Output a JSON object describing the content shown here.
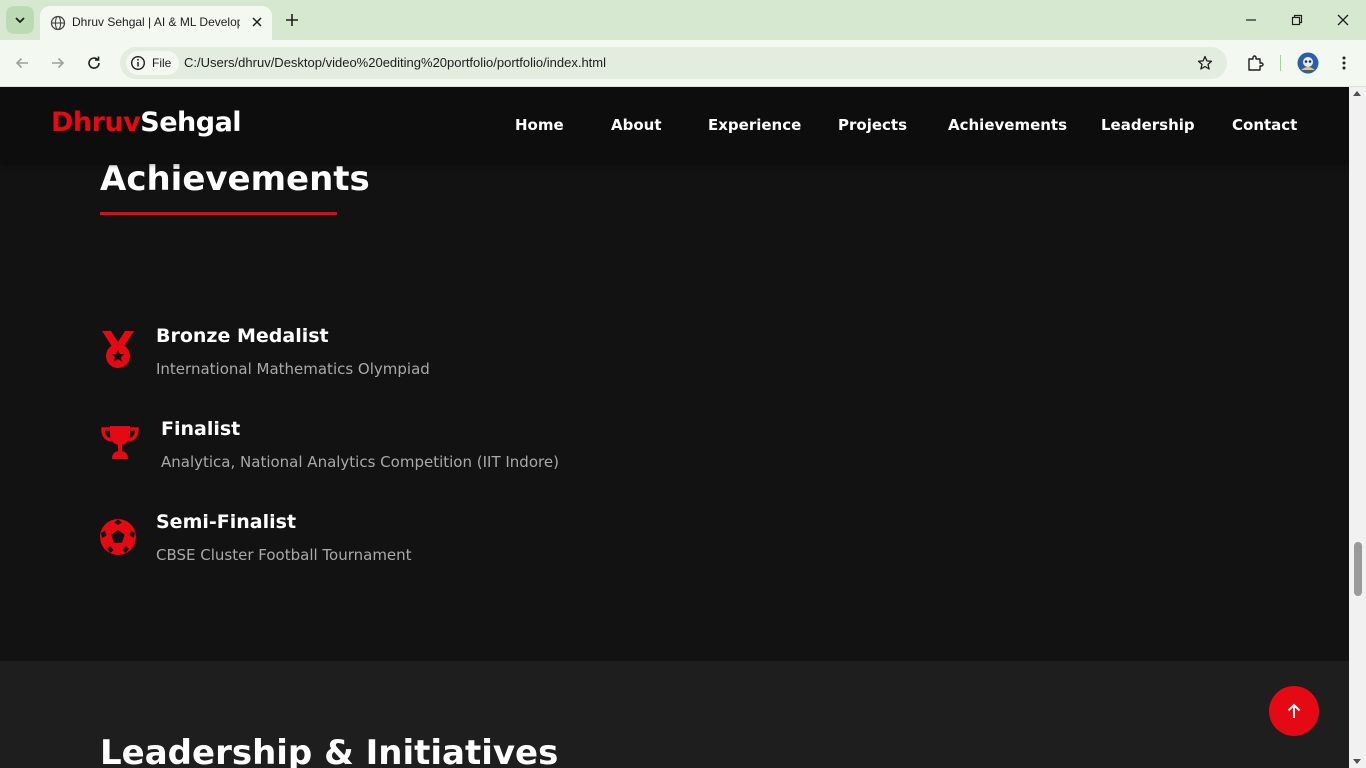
{
  "browser": {
    "tab_title": "Dhruv Sehgal | AI & ML Developer",
    "site_chip_label": "File",
    "url": "C:/Users/dhruv/Desktop/video%20editing%20portfolio/portfolio/index.html"
  },
  "site": {
    "logo_first": "Dhruv",
    "logo_last": "Sehgal",
    "nav": [
      "Home",
      "About",
      "Experience",
      "Projects",
      "Achievements",
      "Leadership",
      "Contact"
    ]
  },
  "achievements": {
    "heading": "Achievements",
    "items": [
      {
        "icon": "medal-icon",
        "title": "Bronze Medalist",
        "subtitle": "International Mathematics Olympiad"
      },
      {
        "icon": "trophy-icon",
        "title": "Finalist",
        "subtitle": "Analytica, National Analytics Competition (IIT Indore)"
      },
      {
        "icon": "football-icon",
        "title": "Semi-Finalist",
        "subtitle": "CBSE Cluster Football Tournament"
      }
    ]
  },
  "leadership": {
    "heading": "Leadership & Initiatives"
  },
  "colors": {
    "accent": "#e50914",
    "page_bg": "#121212",
    "section_alt_bg": "#1e1e1e",
    "browser_frame": "#d6e8d0"
  }
}
